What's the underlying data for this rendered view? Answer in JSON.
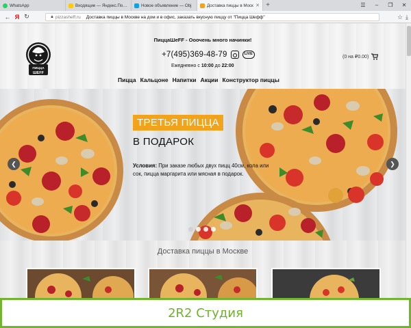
{
  "browser": {
    "tabs": [
      {
        "label": "WhatsApp",
        "favicon_color": "#25d366",
        "active": false
      },
      {
        "label": "Входящие — Яндекс.Почта",
        "favicon_color": "#ffcc00",
        "active": false
      },
      {
        "label": "Новое объявление — Obj",
        "favicon_color": "#0aa3e8",
        "active": false
      },
      {
        "label": "Доставка пиццы в Моск",
        "favicon_color": "#f0a31b",
        "active": true
      }
    ],
    "new_tab": "+",
    "window_controls": [
      "☰",
      "–",
      "❐",
      "✕"
    ],
    "url_domain": "pizzasheff.ru",
    "page_title": "Доставка пиццы в Москве на дом и в офис, заказать вкусную пиццу от \"Пицца Шефф\"",
    "icons": [
      "back-icon",
      "yandex-icon",
      "reload-icon",
      "lock-icon",
      "bookmark-icon",
      "download-icon"
    ]
  },
  "header": {
    "logo_text": "ПИЦЦА ШЕFF",
    "slogan": "ПиццаШеFF - Ооочень много начинки!",
    "phone": "+7(495)369-48-79",
    "live_label": "LIVE",
    "hours_prefix": "Ежедневно с ",
    "hours_from": "10:00",
    "hours_mid": " до ",
    "hours_to": "22:00",
    "cart": "(0 на ₽0.00)",
    "menu": [
      "Пицца",
      "Кальцоне",
      "Напитки",
      "Акции",
      "Конструктор пиццы"
    ]
  },
  "hero": {
    "title": "ТРЕТЬЯ ПИЦЦА",
    "subtitle": "В ПОДАРОК",
    "conditions_label": "Условия:",
    "conditions_text": " При заказе любых двух пицц 40см, кола или сок, пицца маргарита или мясная в подарок.",
    "prev": "❮",
    "next": "❯",
    "slides": 4,
    "active_slide": 0,
    "accent": "#f0a31b"
  },
  "section": {
    "title": "Доставка пиццы в Москве"
  },
  "watermark": {
    "text": "2R2 Студия",
    "color": "#6fb12a"
  }
}
